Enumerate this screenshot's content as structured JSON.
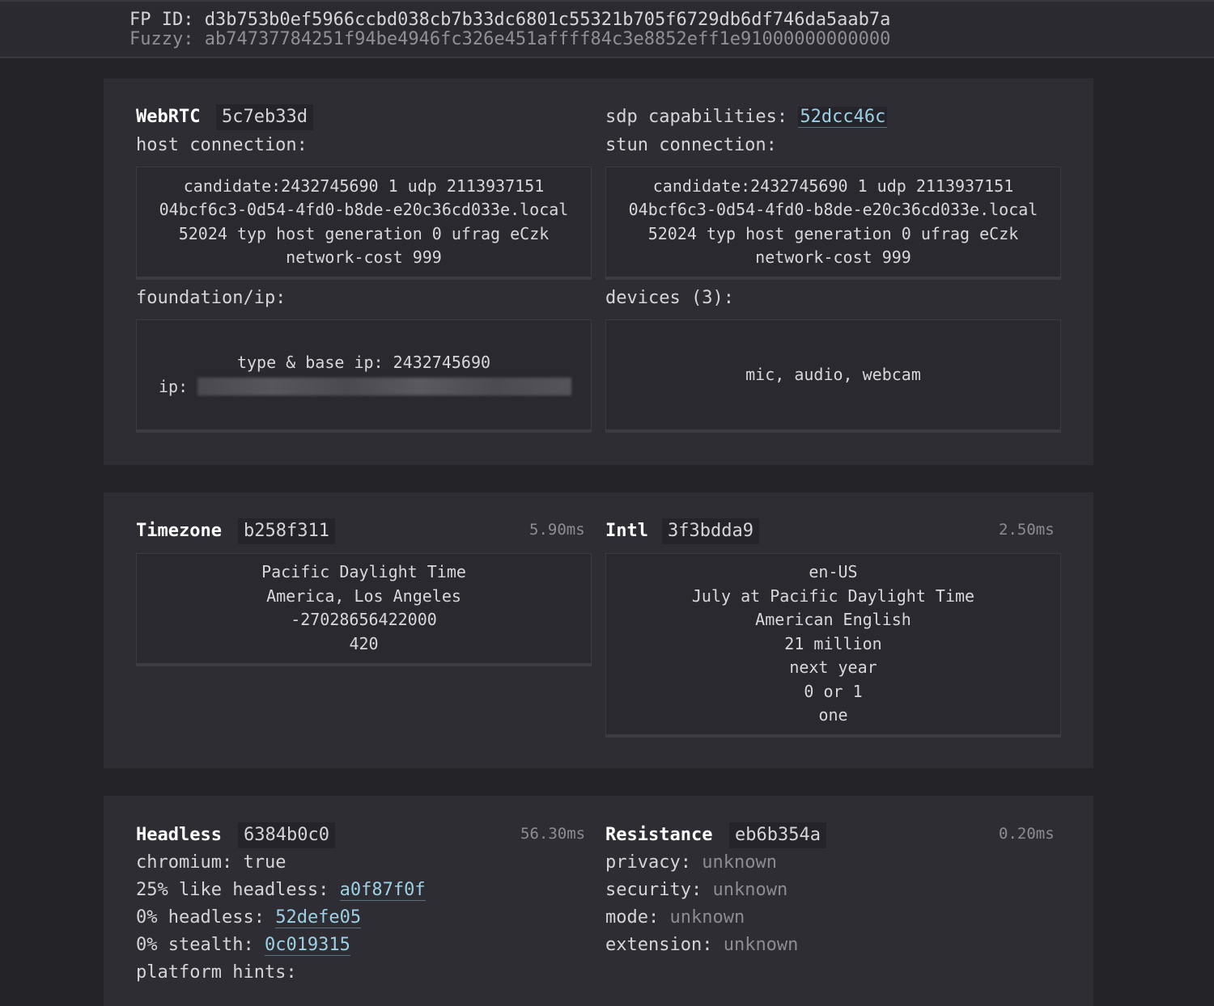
{
  "header": {
    "fp_id": "FP ID: d3b753b0ef5966ccbd038cb7b33dc6801c55321b705f6729db6df746da5aab7a",
    "fuzzy": "Fuzzy: ab74737784251f94be4946fc326e451affff84c3e8852eff1e91000000000000"
  },
  "webrtc": {
    "title": "WebRTC",
    "hash": "5c7eb33d",
    "sdp_label": "sdp capabilities:",
    "sdp_hash": "52dcc46c",
    "host_label": "host connection:",
    "stun_label": "stun connection:",
    "host_lines": [
      "candidate:2432745690 1 udp 2113937151",
      "04bcf6c3-0d54-4fd0-b8de-e20c36cd033e.local",
      "52024 typ host generation 0 ufrag eCzk",
      "network-cost 999"
    ],
    "stun_lines": [
      "candidate:2432745690 1 udp 2113937151",
      "04bcf6c3-0d54-4fd0-b8de-e20c36cd033e.local",
      "52024 typ host generation 0 ufrag eCzk",
      "network-cost 999"
    ],
    "foundation_label": "foundation/ip:",
    "foundation_line": "type & base ip: 2432745690",
    "ip_label": "ip:",
    "devices_label": "devices (3):",
    "devices_value": "mic, audio, webcam"
  },
  "timezone": {
    "title": "Timezone",
    "hash": "b258f311",
    "time": "5.90ms",
    "lines": [
      "Pacific Daylight Time",
      "America, Los Angeles",
      "-27028656422000",
      "420"
    ]
  },
  "intl": {
    "title": "Intl",
    "hash": "3f3bdda9",
    "time": "2.50ms",
    "lines": [
      "en-US",
      "July at Pacific Daylight Time",
      "American English",
      "21 million",
      "next year",
      "0 or 1",
      "one"
    ]
  },
  "headless": {
    "title": "Headless",
    "hash": "6384b0c0",
    "time": "56.30ms",
    "chromium_label": "chromium:",
    "chromium_value": "true",
    "like_label": "25% like headless:",
    "like_hash": "a0f87f0f",
    "headless_label": "0% headless:",
    "headless_hash": "52defe05",
    "stealth_label": "0% stealth:",
    "stealth_hash": "0c019315",
    "platform_label": "platform hints:"
  },
  "resistance": {
    "title": "Resistance",
    "hash": "eb6b354a",
    "time": "0.20ms",
    "privacy_label": "privacy:",
    "privacy_value": "unknown",
    "security_label": "security:",
    "security_value": "unknown",
    "mode_label": "mode:",
    "mode_value": "unknown",
    "extension_label": "extension:",
    "extension_value": "unknown"
  }
}
